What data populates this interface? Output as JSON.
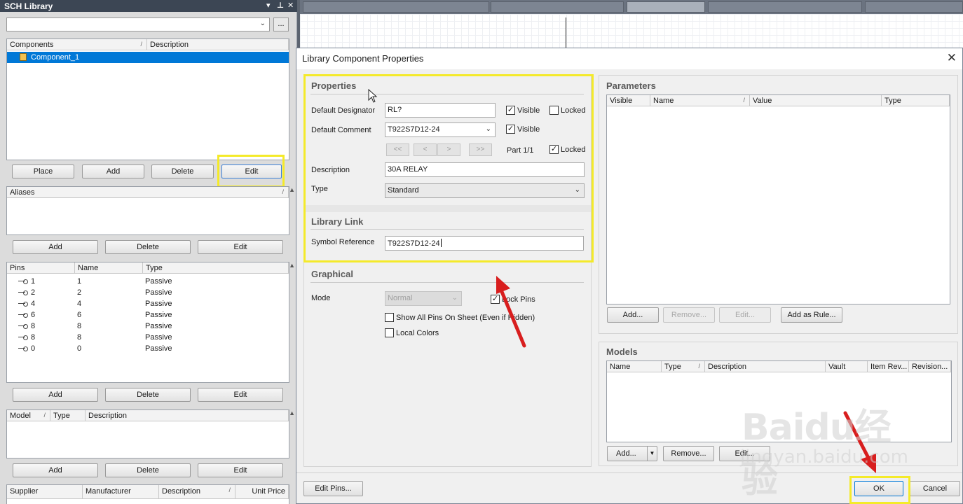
{
  "library_panel": {
    "title": "SCH Library",
    "filter_value": "",
    "browse_label": "...",
    "components_headers": [
      "Components",
      "Description"
    ],
    "components": [
      {
        "name": "Component_1",
        "description": ""
      }
    ],
    "component_buttons": {
      "place": "Place",
      "add": "Add",
      "delete": "Delete",
      "edit": "Edit"
    },
    "aliases_header": "Aliases",
    "alias_buttons": {
      "add": "Add",
      "delete": "Delete",
      "edit": "Edit"
    },
    "pins_headers": [
      "Pins",
      "Name",
      "Type"
    ],
    "pins": [
      {
        "pin": "1",
        "name": "1",
        "type": "Passive"
      },
      {
        "pin": "2",
        "name": "2",
        "type": "Passive"
      },
      {
        "pin": "4",
        "name": "4",
        "type": "Passive"
      },
      {
        "pin": "6",
        "name": "6",
        "type": "Passive"
      },
      {
        "pin": "8",
        "name": "8",
        "type": "Passive"
      },
      {
        "pin": "8",
        "name": "8",
        "type": "Passive"
      },
      {
        "pin": "0",
        "name": "0",
        "type": "Passive"
      }
    ],
    "pin_buttons": {
      "add": "Add",
      "delete": "Delete",
      "edit": "Edit"
    },
    "model_headers": [
      "Model",
      "Type",
      "Description"
    ],
    "model_buttons": {
      "add": "Add",
      "delete": "Delete",
      "edit": "Edit"
    },
    "supplier_headers": [
      "Supplier",
      "Manufacturer",
      "Description",
      "Unit Price"
    ]
  },
  "dialog": {
    "title": "Library Component Properties",
    "properties": {
      "title": "Properties",
      "default_designator_label": "Default Designator",
      "default_designator_value": "RL?",
      "designator_visible_label": "Visible",
      "designator_visible": true,
      "designator_locked_label": "Locked",
      "designator_locked": false,
      "default_comment_label": "Default Comment",
      "default_comment_value": "T922S7D12-24",
      "comment_visible_label": "Visible",
      "comment_visible": true,
      "nav_buttons": [
        "<<",
        "<",
        ">",
        ">>"
      ],
      "part_label": "Part 1/1",
      "part_locked_label": "Locked",
      "part_locked": true,
      "description_label": "Description",
      "description_value": "30A RELAY",
      "type_label": "Type",
      "type_value": "Standard"
    },
    "library_link": {
      "title": "Library Link",
      "symbol_reference_label": "Symbol Reference",
      "symbol_reference_value": "T922S7D12-24"
    },
    "graphical": {
      "title": "Graphical",
      "mode_label": "Mode",
      "mode_value": "Normal",
      "lock_pins_label": "Lock Pins",
      "lock_pins": true,
      "show_all_pins_label": "Show All Pins On Sheet (Even if Hidden)",
      "show_all_pins": false,
      "local_colors_label": "Local Colors",
      "local_colors": false
    },
    "parameters": {
      "title": "Parameters",
      "headers": [
        "Visible",
        "Name",
        "Value",
        "Type"
      ],
      "buttons": {
        "add": "Add...",
        "remove": "Remove...",
        "edit": "Edit...",
        "add_as_rule": "Add as Rule..."
      }
    },
    "models": {
      "title": "Models",
      "headers": [
        "Name",
        "Type",
        "Description",
        "Vault",
        "Item Rev...",
        "Revision..."
      ],
      "buttons": {
        "add": "Add...",
        "remove": "Remove...",
        "edit": "Edit..."
      }
    },
    "footer": {
      "edit_pins": "Edit Pins...",
      "ok": "OK",
      "cancel": "Cancel"
    }
  },
  "watermark": {
    "main": "Baidu经验",
    "sub": "jingyan.baidu.com"
  },
  "colors": {
    "highlight": "#f4ea2a",
    "selection": "#0078d7",
    "arrow": "#d81e1e"
  }
}
